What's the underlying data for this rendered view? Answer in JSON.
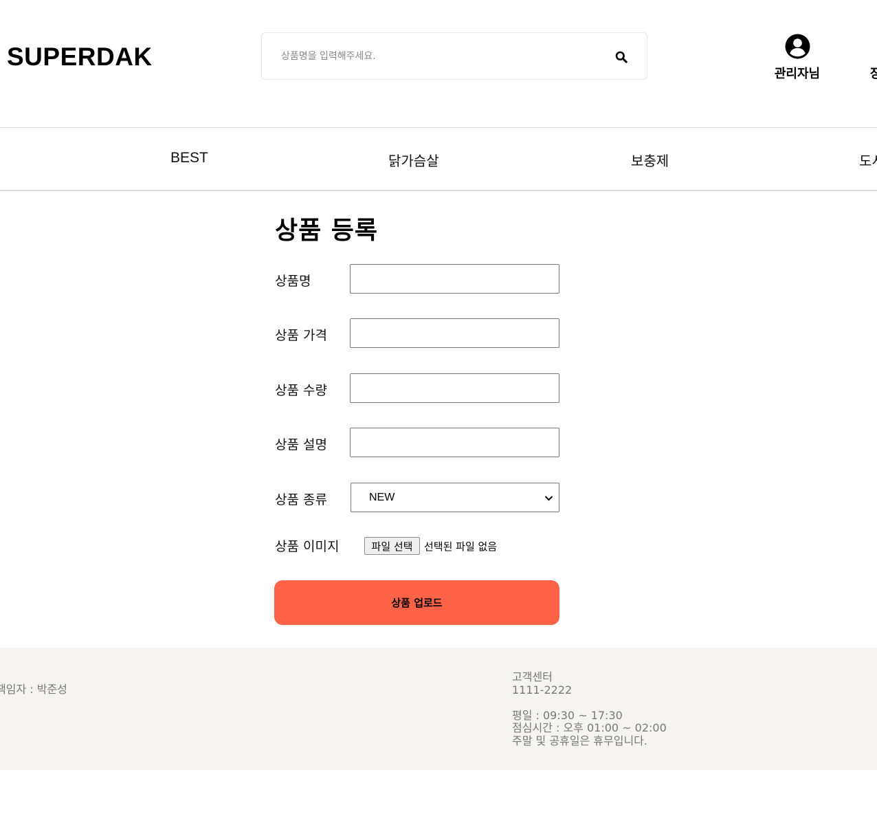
{
  "header": {
    "logo": "SUPERDAK",
    "search": {
      "placeholder": "상품명을 입력해주세요.",
      "value": ""
    },
    "user_label": "관리자님",
    "cart_label": "장"
  },
  "nav": {
    "items": [
      {
        "label": "BEST"
      },
      {
        "label": "닭가슴살"
      },
      {
        "label": "보충제"
      },
      {
        "label": "도시"
      }
    ]
  },
  "form": {
    "title": "상품 등록",
    "fields": [
      {
        "label": "상품명",
        "value": ""
      },
      {
        "label": "상품 가격",
        "value": ""
      },
      {
        "label": "상품 수량",
        "value": ""
      },
      {
        "label": "상품 설명",
        "value": ""
      }
    ],
    "category": {
      "label": "상품 종류",
      "selected": "NEW"
    },
    "image": {
      "label": "상품 이미지",
      "button": "파일 선택",
      "status": "선택된 파일 없음"
    },
    "submit_label": "상품 업로드"
  },
  "footer": {
    "manager": "책임자 : 박준성",
    "cs_title": "고객센터",
    "cs_phone": "1111-2222",
    "weekday_hours": "평일 : 09:30 ~ 17:30",
    "lunch_hours": "점심시간 : 오후 01:00 ~ 02:00",
    "holiday_note": "주말 및 공휴일은 휴무입니다."
  },
  "colors": {
    "accent": "#ff6347",
    "footer_bg": "#f5f4f2",
    "footer_text": "#777777"
  },
  "icons": {
    "search": "search-icon",
    "user": "user-circle-icon",
    "select": "chevron-down-icon"
  }
}
